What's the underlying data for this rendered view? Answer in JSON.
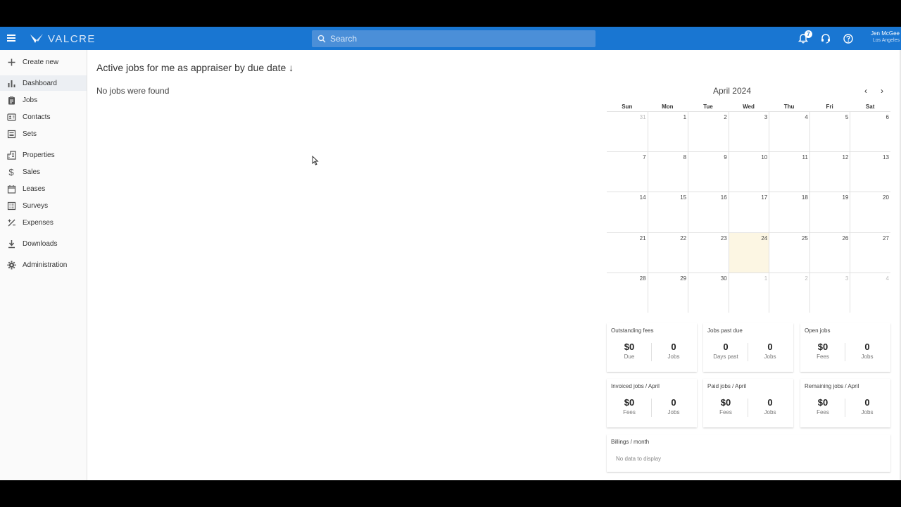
{
  "topbar": {
    "brand": "VALCRE",
    "search_placeholder": "Search",
    "notification_count": "7",
    "user_name": "Jen McGee",
    "user_location": "Los Angeles",
    "bg_color": "#1976d2"
  },
  "sidebar": {
    "items": [
      {
        "label": "Create new",
        "icon": "plus-icon"
      },
      {
        "label": "Dashboard",
        "icon": "bar-chart-icon",
        "active": true
      },
      {
        "label": "Jobs",
        "icon": "clipboard-icon"
      },
      {
        "label": "Contacts",
        "icon": "contact-card-icon"
      },
      {
        "label": "Sets",
        "icon": "list-icon"
      },
      {
        "label": "Properties",
        "icon": "building-icon"
      },
      {
        "label": "Sales",
        "icon": "dollar-icon"
      },
      {
        "label": "Leases",
        "icon": "calendar-icon"
      },
      {
        "label": "Surveys",
        "icon": "survey-icon"
      },
      {
        "label": "Expenses",
        "icon": "percent-icon"
      },
      {
        "label": "Downloads",
        "icon": "download-icon"
      },
      {
        "label": "Administration",
        "icon": "gear-icon"
      }
    ]
  },
  "main": {
    "title": "Active jobs for me as appraiser by due date ↓",
    "empty_message": "No jobs were found"
  },
  "calendar": {
    "title": "April 2024",
    "prev_label": "‹",
    "next_label": "›",
    "weekdays": [
      "Sun",
      "Mon",
      "Tue",
      "Wed",
      "Thu",
      "Fri",
      "Sat"
    ],
    "weeks": [
      [
        "31",
        "1",
        "2",
        "3",
        "4",
        "5",
        "6"
      ],
      [
        "7",
        "8",
        "9",
        "10",
        "11",
        "12",
        "13"
      ],
      [
        "14",
        "15",
        "16",
        "17",
        "18",
        "19",
        "20"
      ],
      [
        "21",
        "22",
        "23",
        "24",
        "25",
        "26",
        "27"
      ],
      [
        "28",
        "29",
        "30",
        "1",
        "2",
        "3",
        "4"
      ]
    ],
    "today_highlight": "#fcf6e3"
  },
  "cards": [
    {
      "title": "Outstanding fees",
      "a_value": "$0",
      "a_label": "Due",
      "b_value": "0",
      "b_label": "Jobs"
    },
    {
      "title": "Jobs past due",
      "a_value": "0",
      "a_label": "Days past",
      "b_value": "0",
      "b_label": "Jobs"
    },
    {
      "title": "Open jobs",
      "a_value": "$0",
      "a_label": "Fees",
      "b_value": "0",
      "b_label": "Jobs"
    },
    {
      "title": "Invoiced jobs / April",
      "a_value": "$0",
      "a_label": "Fees",
      "b_value": "0",
      "b_label": "Jobs"
    },
    {
      "title": "Paid jobs / April",
      "a_value": "$0",
      "a_label": "Fees",
      "b_value": "0",
      "b_label": "Jobs"
    },
    {
      "title": "Remaining jobs / April",
      "a_value": "$0",
      "a_label": "Fees",
      "b_value": "0",
      "b_label": "Jobs"
    }
  ],
  "billings": {
    "title": "Billings / month",
    "empty_message": "No data to display"
  }
}
